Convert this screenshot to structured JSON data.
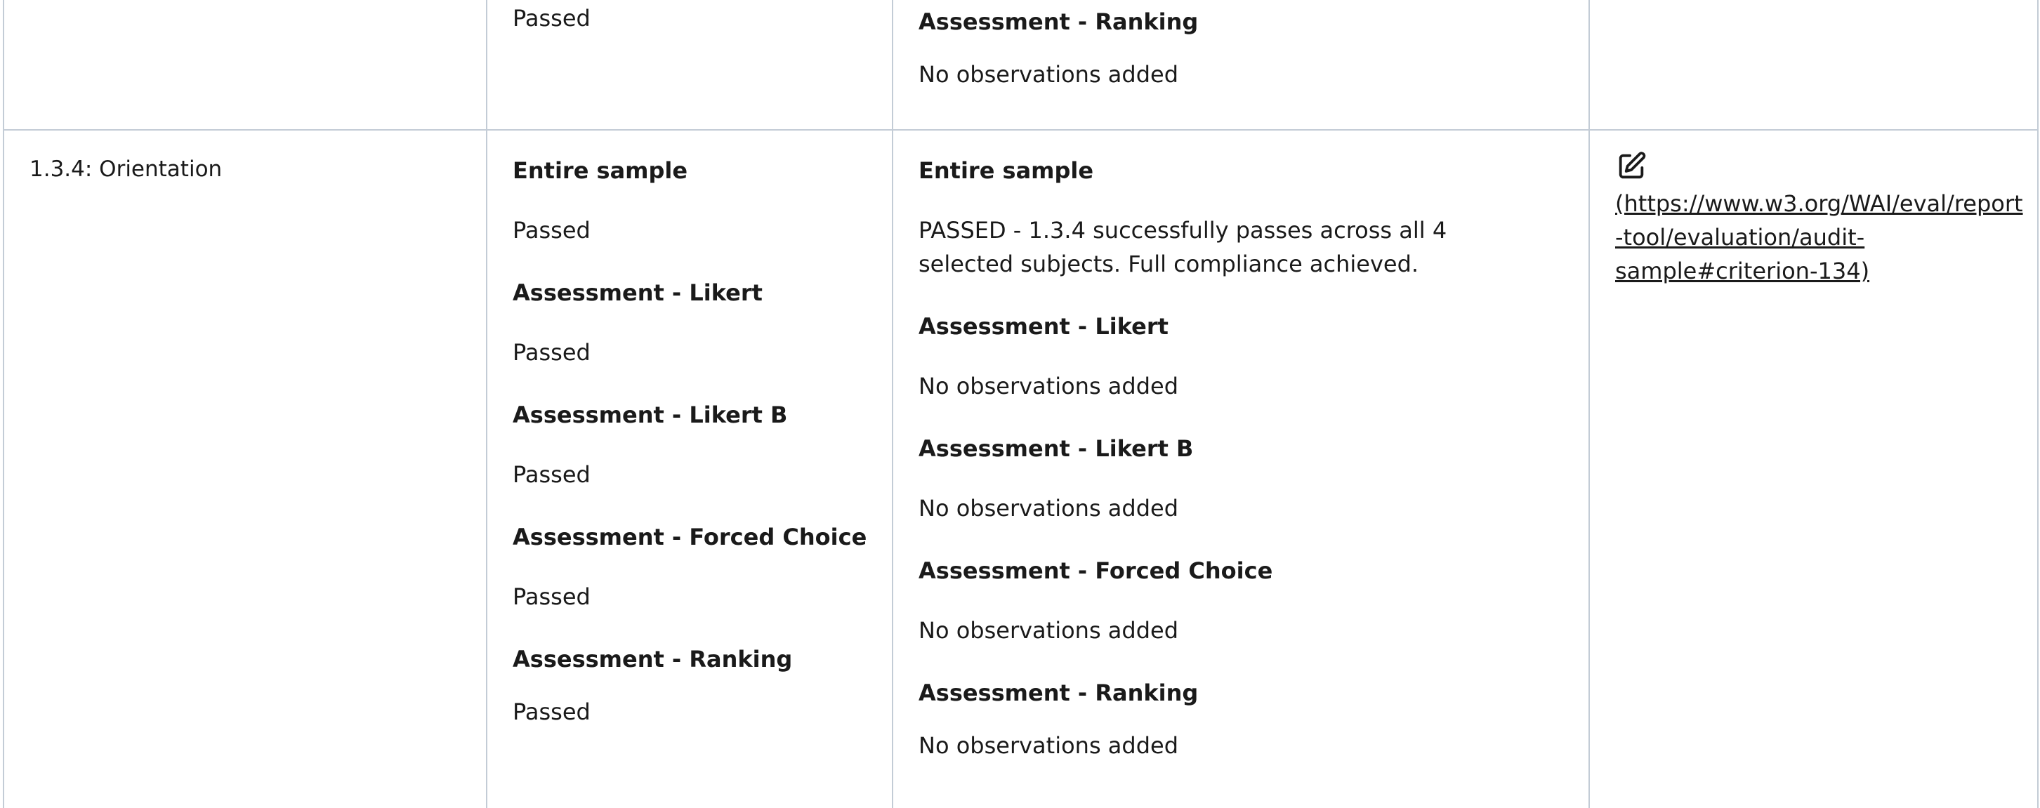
{
  "previous_row": {
    "sample_result_tail": "Passed",
    "observations_tail": {
      "heading": "Assessment - Ranking",
      "text": "No observations added"
    }
  },
  "criterion_row": {
    "criterion": "1.3.4: Orientation",
    "results": [
      {
        "heading": "Entire sample",
        "value": "Passed"
      },
      {
        "heading": "Assessment - Likert",
        "value": "Passed"
      },
      {
        "heading": "Assessment - Likert B",
        "value": "Passed"
      },
      {
        "heading": "Assessment - Forced Choice",
        "value": "Passed"
      },
      {
        "heading": "Assessment - Ranking",
        "value": "Passed"
      }
    ],
    "observations": [
      {
        "heading": "Entire sample",
        "text": "PASSED - 1.3.4 successfully passes across all 4 selected subjects. Full compliance achieved."
      },
      {
        "heading": "Assessment - Likert",
        "text": "No observations added"
      },
      {
        "heading": "Assessment - Likert B",
        "text": "No observations added"
      },
      {
        "heading": "Assessment - Forced Choice",
        "text": "No observations added"
      },
      {
        "heading": "Assessment - Ranking",
        "text": "No observations added"
      }
    ],
    "edit": {
      "icon": "edit-icon",
      "link_text": "(https://www.w3.org/WAI/eval/report-tool/evaluation/audit-sample#criterion-134)"
    }
  },
  "colors": {
    "border": "#c3ccd6",
    "text": "#1a1a1a"
  }
}
